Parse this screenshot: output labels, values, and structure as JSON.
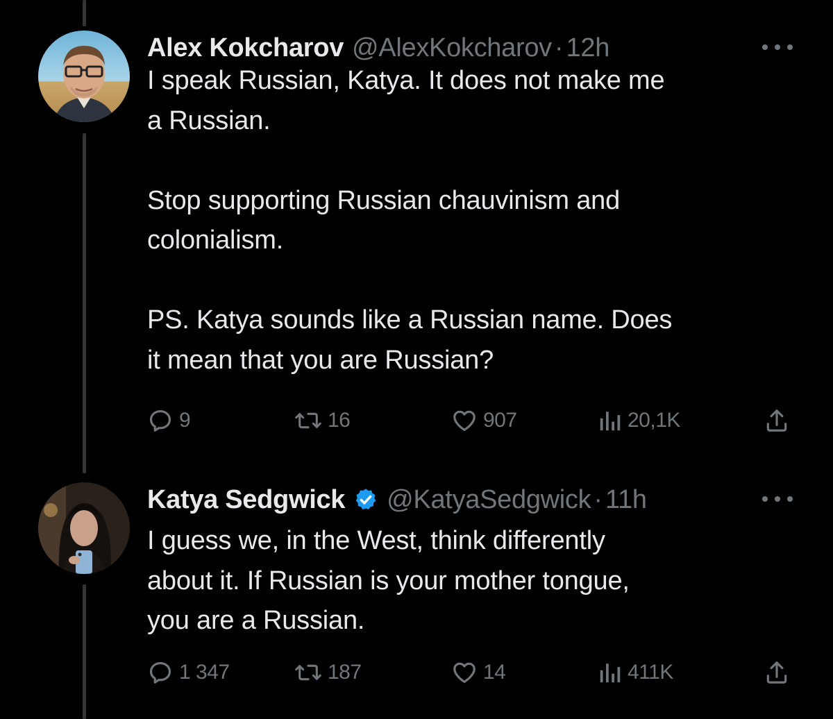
{
  "colors": {
    "background": "#000000",
    "text_primary": "#e7e9ea",
    "text_secondary": "#71767b",
    "verified_blue": "#1d9bf0",
    "thread_line": "#333639"
  },
  "tweets": [
    {
      "author": {
        "name": "Alex Kokcharov",
        "handle": "@AlexKokcharov",
        "verified": false
      },
      "time": "12h",
      "separator": "·",
      "text": "I speak Russian, Katya. It does not make me\na Russian.\n\nStop supporting Russian chauvinism and\ncolonialism.\n\nPS. Katya sounds like a Russian name. Does\nit mean that you are Russian?",
      "stats": {
        "replies": "9",
        "reposts": "16",
        "likes": "907",
        "views": "20,1K"
      }
    },
    {
      "author": {
        "name": "Katya Sedgwick",
        "handle": "@KatyaSedgwick",
        "verified": true
      },
      "time": "11h",
      "separator": "·",
      "text": "I guess we, in the West, think differently\nabout it. If Russian is your mother tongue,\nyou are a Russian.",
      "stats": {
        "replies": "1 347",
        "reposts": "187",
        "likes": "14",
        "views": "411K"
      }
    }
  ],
  "icons": {
    "more": "more-horizontal-icon",
    "reply": "reply-bubble-icon",
    "repost": "repost-arrows-icon",
    "like": "heart-icon",
    "views": "bar-chart-icon",
    "share": "share-upload-icon",
    "verified": "verified-badge-icon"
  }
}
